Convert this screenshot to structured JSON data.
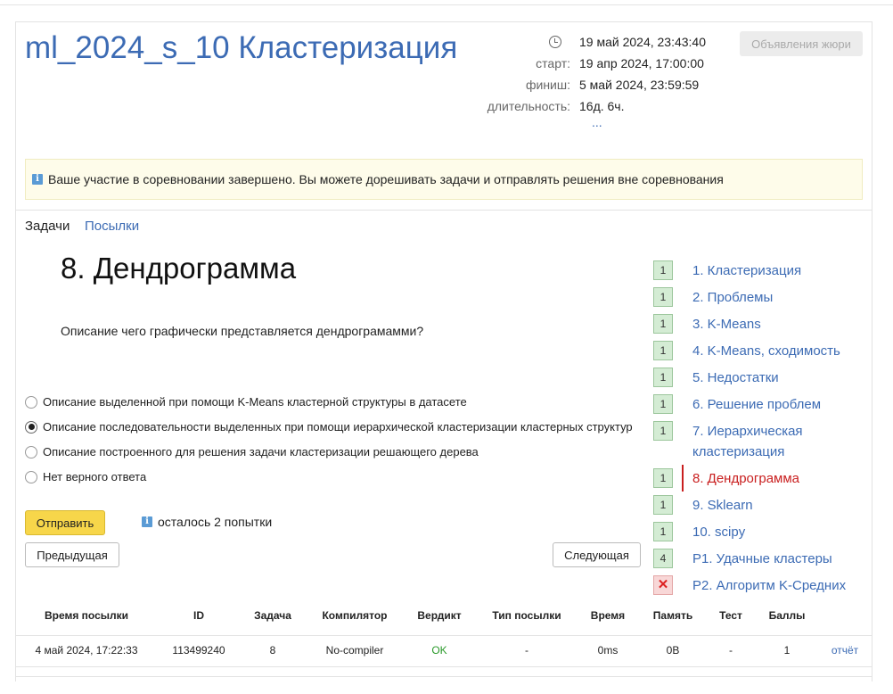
{
  "contest": {
    "title": "ml_2024_s_10 Кластеризация",
    "now": "19 май 2024, 23:43:40",
    "start_label": "старт:",
    "start": "19 апр 2024, 17:00:00",
    "finish_label": "финиш:",
    "finish": "5 май 2024, 23:59:59",
    "duration_label": "длительность:",
    "duration": "16д. 6ч.",
    "more": "...",
    "jury_button": "Объявления жюри"
  },
  "notice": "Ваше участие в соревновании завершено. Вы можете дорешивать задачи и отправлять решения вне соревнования",
  "tabs": {
    "tasks": "Задачи",
    "submissions": "Посылки"
  },
  "problem": {
    "title": "8. Дендрограмма",
    "question": "Описание чего графически представляется дендрограмамми?",
    "options": [
      "Описание выделенной при помощи K-Means кластерной структуры в датасете",
      "Описание последовательности выделенных при помощи иерархической кластеризации кластерных структур",
      "Описание построенного для решения задачи кластеризации решающего дерева",
      "Нет верного ответа"
    ],
    "selected_option": 2,
    "submit": "Отправить",
    "attempts": "осталось 2 попытки",
    "prev": "Предыдущая",
    "next": "Следующая"
  },
  "sidebar": [
    {
      "badge": "1",
      "label": "1. Кластеризация"
    },
    {
      "badge": "1",
      "label": "2. Проблемы"
    },
    {
      "badge": "1",
      "label": "3. K-Means"
    },
    {
      "badge": "1",
      "label": "4. K-Means, сходимость"
    },
    {
      "badge": "1",
      "label": "5. Недостатки"
    },
    {
      "badge": "1",
      "label": "6. Решение проблем"
    },
    {
      "badge": "1",
      "label": "7. Иерархическая кластеризация"
    },
    {
      "badge": "1",
      "label": "8. Дендрограмма"
    },
    {
      "badge": "1",
      "label": "9. Sklearn"
    },
    {
      "badge": "1",
      "label": "10. scipy"
    },
    {
      "badge": "4",
      "label": "P1. Удачные кластеры"
    },
    {
      "badge": "✕",
      "label": "P2. Алгоритм K-Средних"
    }
  ],
  "table": {
    "headers": [
      "Время посылки",
      "ID",
      "Задача",
      "Компилятор",
      "Вердикт",
      "Тип посылки",
      "Время",
      "Память",
      "Тест",
      "Баллы"
    ],
    "rows": [
      [
        "4 май 2024, 17:22:33",
        "113499240",
        "8",
        "No-compiler",
        "OK",
        "-",
        "0ms",
        "0B",
        "-",
        "1",
        "отчёт"
      ]
    ]
  },
  "colors": {
    "link": "#3c6bb4",
    "active": "#c91f1f",
    "ok": "#2a9a2a",
    "submit": "#f7d64a"
  }
}
